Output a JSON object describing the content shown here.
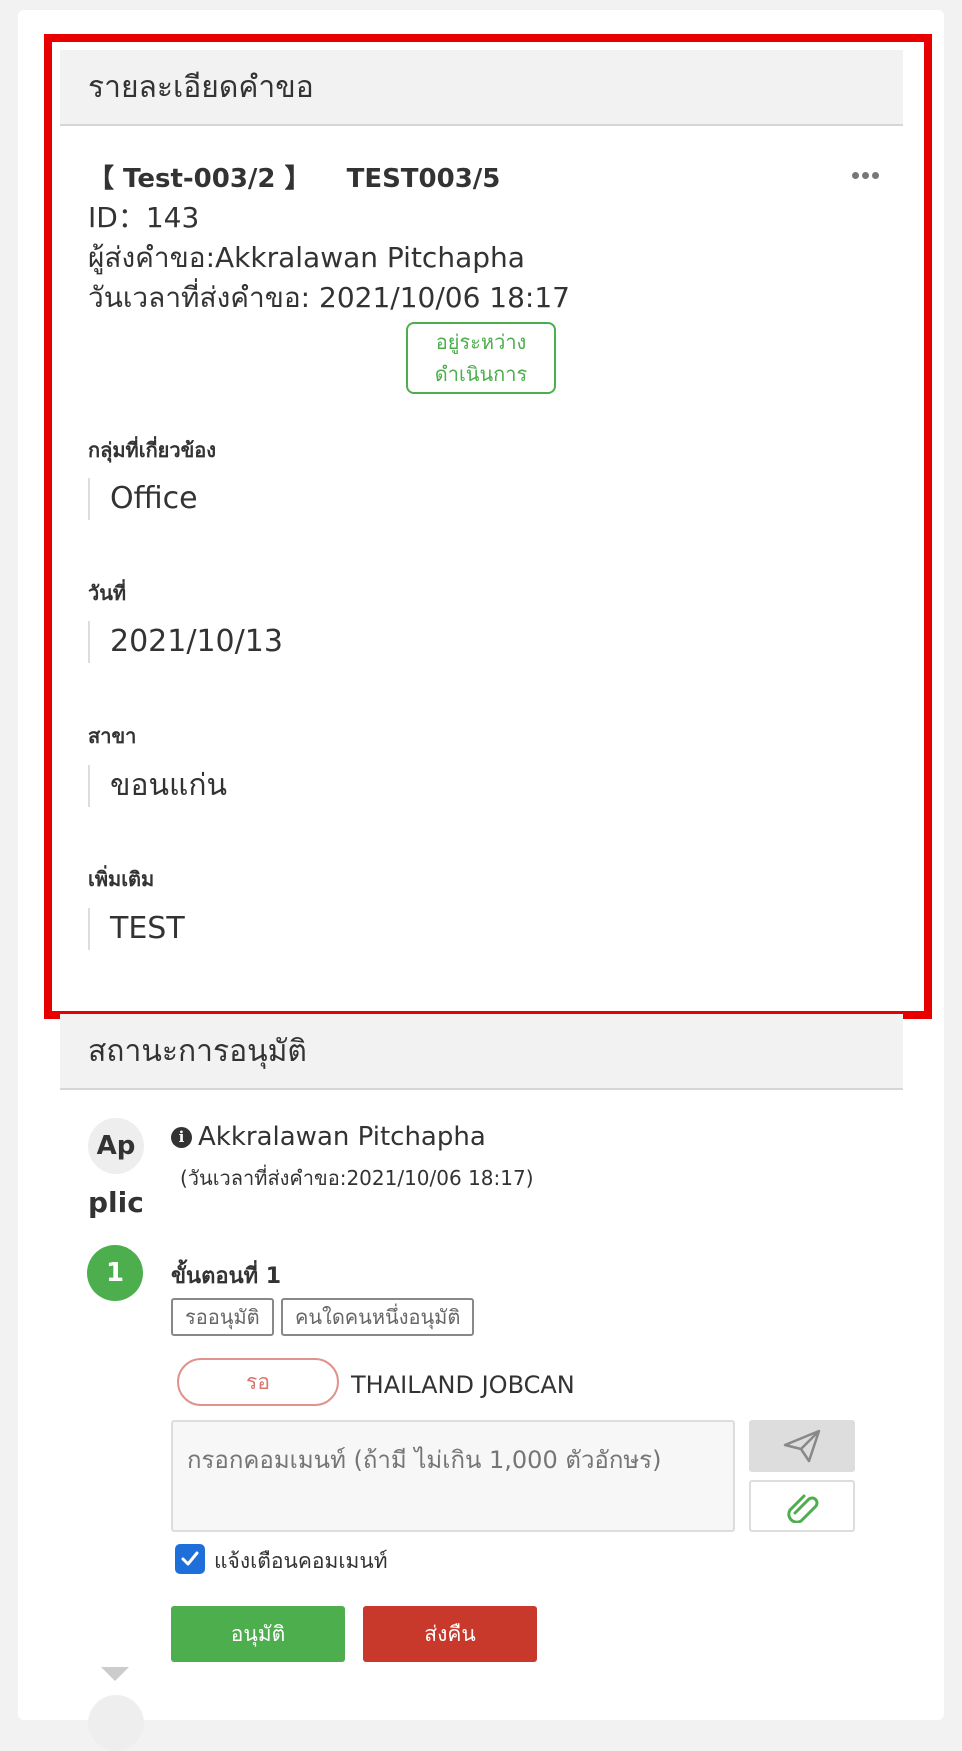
{
  "details": {
    "header": "รายละเอียดคำขอ",
    "form_code": "【 Test-003/2 】",
    "form_title": "TEST003/5",
    "id_line": "ID：143",
    "requester_line": "ผู้ส่งคำขอ:Akkralawan Pitchapha",
    "sent_at_line": "วันเวลาที่ส่งคำขอ: 2021/10/06 18:17",
    "status_line1": "อยู่ระหว่าง",
    "status_line2": "ดำเนินการ",
    "fields": [
      {
        "label": "กลุ่มที่เกี่ยวข้อง",
        "value": "Office"
      },
      {
        "label": "วันที่",
        "value": "2021/10/13"
      },
      {
        "label": "สาขา",
        "value": "ขอนแก่น"
      },
      {
        "label": "เพิ่มเติม",
        "value": "TEST"
      }
    ]
  },
  "approval": {
    "header": "สถานะการอนุมัติ",
    "applicant": {
      "avatar_text": "Ap",
      "avatar_overflow": "plic",
      "name": "Akkralawan Pitchapha",
      "sent_at": "(วันเวลาที่ส่งคำขอ:2021/10/06 18:17)"
    },
    "step": {
      "number": "1",
      "title": "ขั้นตอนที่ 1",
      "tags": [
        "รออนุมัติ",
        "คนใดคนหนึ่งอนุมัติ"
      ],
      "wait_label": "รอ",
      "approver": "THAILAND JOBCAN"
    },
    "comment_placeholder": "กรอกคอมเมนท์ (ถ้ามี ไม่เกิน 1,000 ตัวอักษร)",
    "notify_label": "แจ้งเตือนคอมเมนท์",
    "notify_checked": true,
    "approve_label": "อนุมัติ",
    "return_label": "ส่งคืน"
  },
  "colors": {
    "accent_green": "#4cae4c",
    "return_red": "#c9392b",
    "highlight_frame": "#e80000",
    "checkbox_blue": "#1e6fd9"
  }
}
